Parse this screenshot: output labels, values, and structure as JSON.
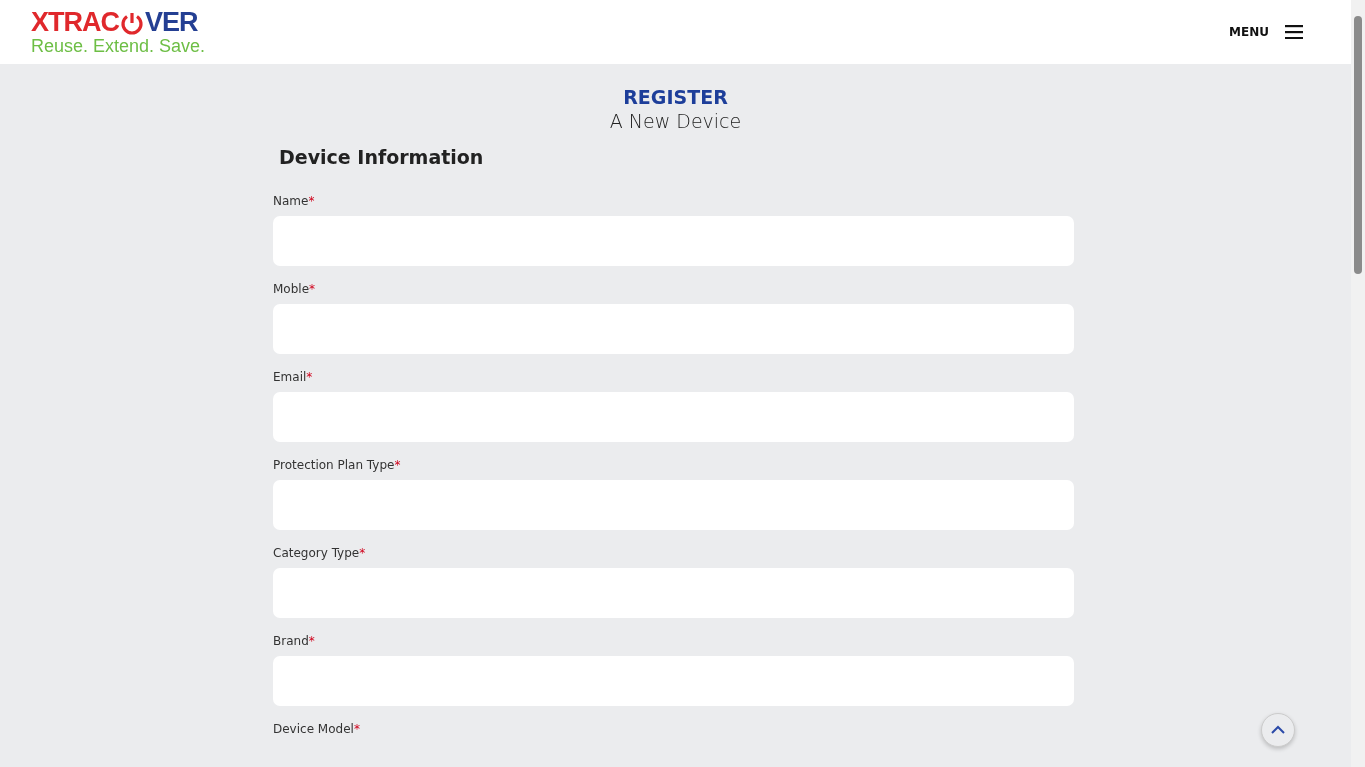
{
  "header": {
    "logo": {
      "left": "XTRAC",
      "right": "VER",
      "tagline": "Reuse. Extend. Save."
    },
    "menu": {
      "label": "MENU"
    }
  },
  "title": {
    "main": "REGISTER",
    "sub": "A New Device"
  },
  "section": {
    "heading": "Device Information"
  },
  "fields": [
    {
      "label": "Name",
      "required_mark": "*"
    },
    {
      "label": "Moble",
      "required_mark": "*"
    },
    {
      "label": "Email",
      "required_mark": "*"
    },
    {
      "label": "Protection Plan Type",
      "required_mark": "*"
    },
    {
      "label": "Category Type",
      "required_mark": "*"
    },
    {
      "label": "Brand",
      "required_mark": "*"
    },
    {
      "label": "Device Model",
      "required_mark": "*"
    }
  ]
}
